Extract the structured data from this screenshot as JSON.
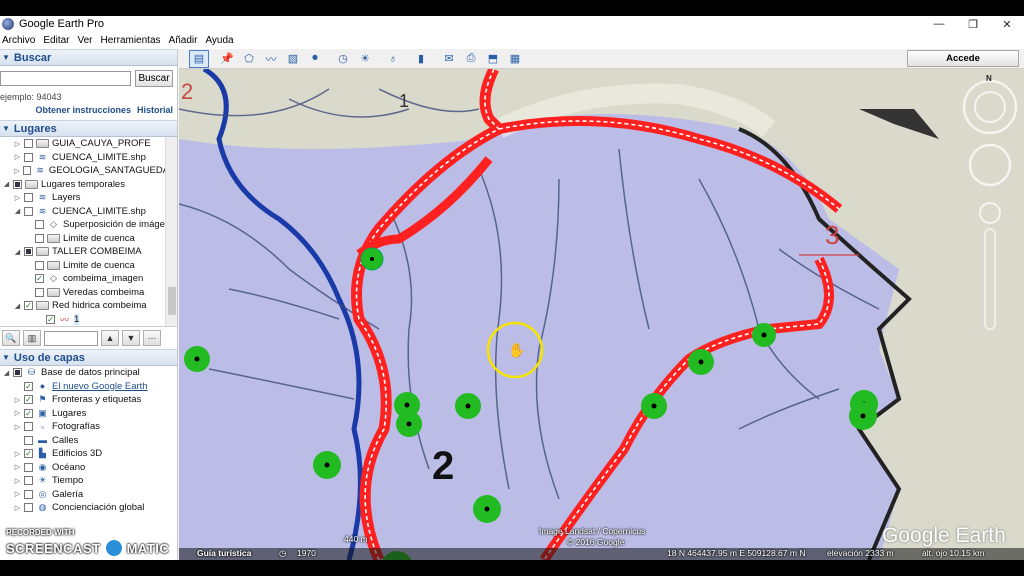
{
  "window": {
    "title": "Google Earth Pro",
    "controls": [
      "—",
      "❐",
      "✕"
    ]
  },
  "menu": [
    "Archivo",
    "Editar",
    "Ver",
    "Herramientas",
    "Añadir",
    "Ayuda"
  ],
  "search": {
    "header": "Buscar",
    "button": "Buscar",
    "hint": "ejemplo: 94043",
    "links": [
      "Obtener instrucciones",
      "Historial"
    ]
  },
  "places": {
    "header": "Lugares",
    "items": [
      {
        "label": "GUIA_CAUYA_PROFE",
        "icon": "folder-icon",
        "indent": 0,
        "tw": "▷",
        "checked": false
      },
      {
        "label": "CUENCA_LIMITE.shp",
        "icon": "layer-icon",
        "indent": 0,
        "tw": "▷",
        "checked": false
      },
      {
        "label": "GEOLOGIA_SANTAGUEDA...",
        "icon": "layer-icon",
        "indent": 0,
        "tw": "▷",
        "checked": false
      },
      {
        "label": "Lugares temporales",
        "icon": "folder-icon",
        "indent": -1,
        "tw": "◢",
        "checked": "partial"
      },
      {
        "label": "Layers",
        "icon": "layer-icon",
        "indent": 0,
        "tw": "▷",
        "checked": false
      },
      {
        "label": "CUENCA_LIMITE.shp",
        "icon": "layer-icon",
        "indent": 0,
        "tw": "◢",
        "checked": false
      },
      {
        "label": "Superposición de imáge...",
        "icon": "overlay-icon",
        "indent": 1,
        "tw": "",
        "checked": false
      },
      {
        "label": "Limite de cuenca",
        "icon": "folder-icon",
        "indent": 1,
        "tw": "",
        "checked": false
      },
      {
        "label": "TALLER COMBEIMA",
        "icon": "folder-icon",
        "indent": 0,
        "tw": "◢",
        "checked": "partial"
      },
      {
        "label": "Limite de cuenca",
        "icon": "folder-icon",
        "indent": 1,
        "tw": "",
        "checked": false
      },
      {
        "label": "combeima_imagen",
        "icon": "overlay-icon",
        "indent": 1,
        "tw": "",
        "checked": true
      },
      {
        "label": "Veredas combeima",
        "icon": "folder-icon",
        "indent": 1,
        "tw": "",
        "checked": false
      },
      {
        "label": "Red hidrica combeima",
        "icon": "folder-icon",
        "indent": 0,
        "tw": "◢",
        "checked": true
      },
      {
        "label": "1",
        "icon": "path-icon",
        "indent": 2,
        "tw": "",
        "checked": true,
        "selected": true
      }
    ]
  },
  "layers": {
    "header": "Uso de capas",
    "items": [
      {
        "label": "Base de datos principal",
        "indent": -1,
        "tw": "◢",
        "checked": "partial",
        "icon": "db-icon",
        "link": false
      },
      {
        "label": "El nuevo Google Earth",
        "indent": 0,
        "tw": "",
        "checked": true,
        "icon": "globe-icon",
        "link": true
      },
      {
        "label": "Fronteras y etiquetas",
        "indent": 0,
        "tw": "▷",
        "checked": true,
        "icon": "flag-icon",
        "link": false
      },
      {
        "label": "Lugares",
        "indent": 0,
        "tw": "▷",
        "checked": true,
        "icon": "places-icon",
        "link": false
      },
      {
        "label": "Fotografías",
        "indent": 0,
        "tw": "▷",
        "checked": false,
        "icon": "photo-icon",
        "link": false
      },
      {
        "label": "Calles",
        "indent": 0,
        "tw": "",
        "checked": false,
        "icon": "road-icon",
        "link": false
      },
      {
        "label": "Edificios 3D",
        "indent": 0,
        "tw": "▷",
        "checked": true,
        "icon": "building-icon",
        "link": false
      },
      {
        "label": "Océano",
        "indent": 0,
        "tw": "▷",
        "checked": false,
        "icon": "ocean-icon",
        "link": false
      },
      {
        "label": "Tiempo",
        "indent": 0,
        "tw": "▷",
        "checked": false,
        "icon": "weather-icon",
        "link": false
      },
      {
        "label": "Galería",
        "indent": 0,
        "tw": "▷",
        "checked": false,
        "icon": "gallery-icon",
        "link": false
      },
      {
        "label": "Concienciación global",
        "indent": 0,
        "tw": "▷",
        "checked": false,
        "icon": "awareness-icon",
        "link": false
      }
    ]
  },
  "toolbar": {
    "login": "Accede"
  },
  "map": {
    "numbers": [
      "2",
      "1",
      "3",
      "2"
    ],
    "compass_north": "N",
    "scale": "440 m",
    "attribution_1": "Image Landsat / Copernicus",
    "attribution_2": "© 2016 Google",
    "logo": "Google Earth"
  },
  "status": {
    "tour": "Guía turística",
    "year": "1970",
    "coords": "18 N 464437.95 m E 509128.67 m N",
    "elevation": "elevación  2333 m",
    "eye": "alt. ojo  10.15 km"
  },
  "watermark": {
    "line1": "RECORDED WITH",
    "line2a": "SCREENCAST",
    "line2b": "MATIC"
  },
  "colors": {
    "river": "#ff2020",
    "marker": "#22bb22",
    "basin": "#b9bce4",
    "stream": "#1a3aa8"
  }
}
